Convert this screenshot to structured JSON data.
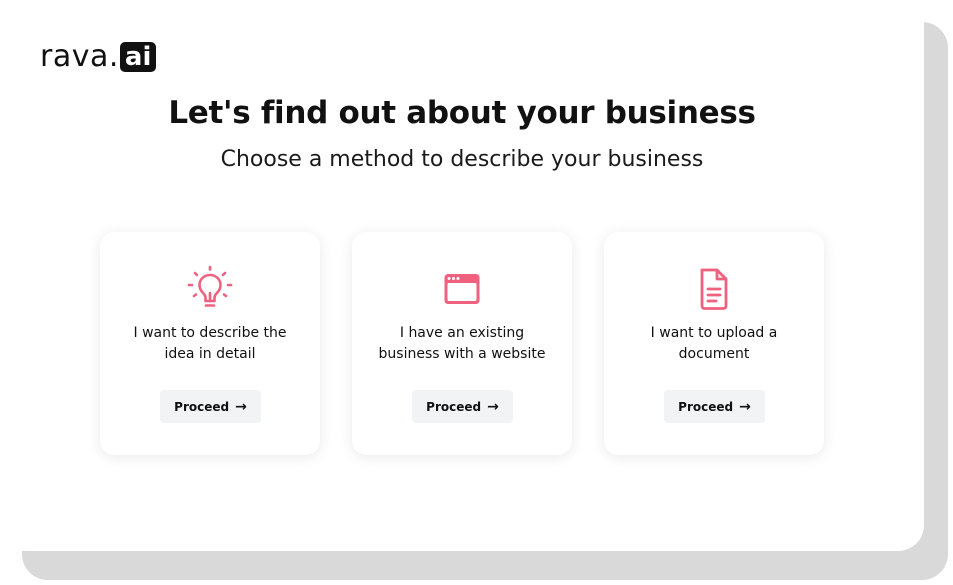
{
  "brand": {
    "name": "rava.",
    "badge": "ai"
  },
  "header": {
    "title": "Let's find out about your business",
    "subtitle": "Choose a method to describe your business"
  },
  "accent_color": "#f0607f",
  "cards": [
    {
      "icon": "lightbulb-icon",
      "line1": "I want to describe the",
      "line2": "idea in detail",
      "button_label": "Proceed",
      "button_arrow": "→"
    },
    {
      "icon": "browser-window-icon",
      "line1": "I have an existing",
      "line2": "business with a website",
      "button_label": "Proceed",
      "button_arrow": "→"
    },
    {
      "icon": "document-icon",
      "line1": "I want to upload a",
      "line2": "document",
      "button_label": "Proceed",
      "button_arrow": "→"
    }
  ]
}
